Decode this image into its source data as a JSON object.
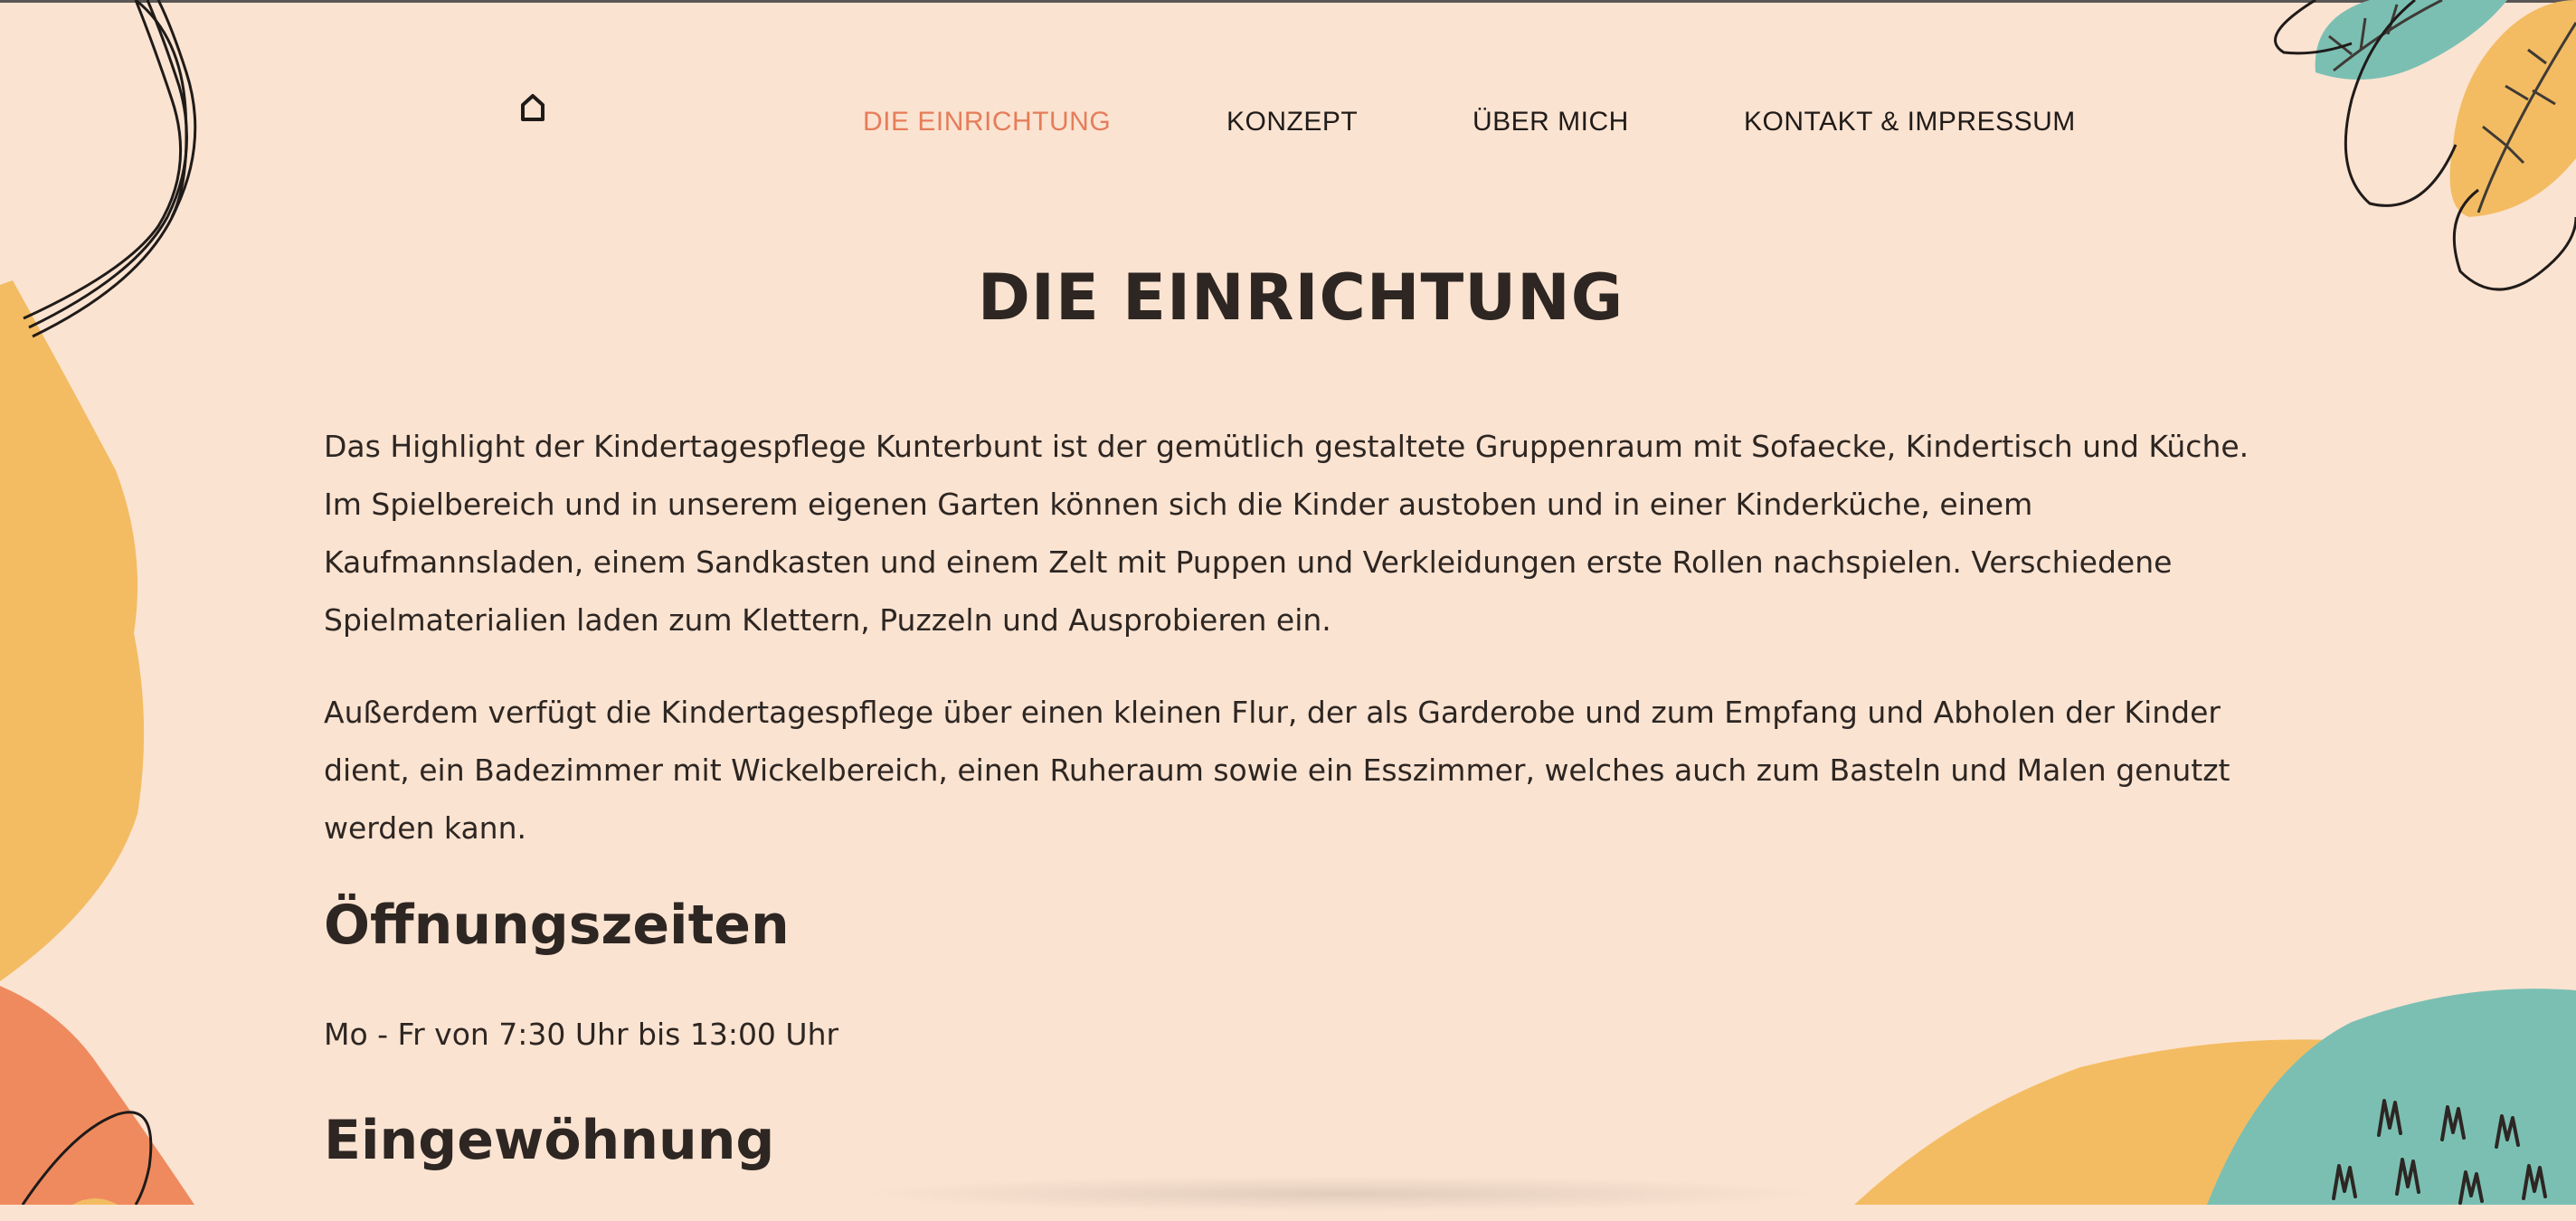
{
  "nav": {
    "home_icon": "home-icon",
    "items": [
      {
        "label": "DIE EINRICHTUNG",
        "active": true
      },
      {
        "label": "KONZEPT",
        "active": false
      },
      {
        "label": "ÜBER MICH",
        "active": false
      },
      {
        "label": "KONTAKT & IMPRESSUM",
        "active": false
      }
    ]
  },
  "page": {
    "title": "DIE EINRICHTUNG",
    "paragraphs": [
      "Das Highlight der Kindertagespflege Kunterbunt ist der gemütlich gestaltete Gruppenraum mit Sofaecke, Kindertisch und Küche. Im Spielbereich und in unserem eigenen Garten können sich die Kinder austoben und in einer Kinderküche, einem Kaufmannsladen, einem Sandkasten und einem Zelt mit Puppen und Verkleidungen erste Rollen nachspielen. Verschiedene Spielmaterialien laden zum Klettern, Puzzeln und Ausprobieren ein.",
      "Außerdem verfügt die Kindertagespflege über einen kleinen Flur, der als Garderobe und zum Empfang und Abholen der Kinder dient, ein Badezimmer mit Wickelbereich, einen Ruheraum sowie ein Esszimmer, welches auch zum Basteln und Malen genutzt werden kann."
    ],
    "opening_heading": "Öffnungszeiten",
    "opening_hours": "Mo - Fr von 7:30 Uhr bis 13:00 Uhr",
    "settling_heading": "Eingewöhnung"
  },
  "colors": {
    "background": "#fbe3d1",
    "accent": "#e57d5a",
    "yellow": "#f3bc62",
    "teal": "#7bbfb3",
    "orange": "#ef8a5f",
    "text": "#2d2622"
  }
}
